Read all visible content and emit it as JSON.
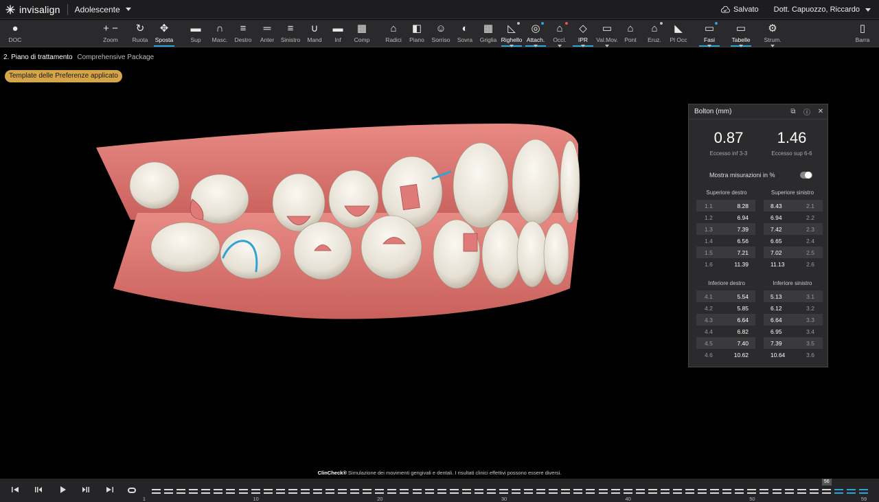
{
  "app": {
    "logo_text": "invisalign",
    "mode": "Adolescente",
    "saved": "Salvato",
    "doctor": "Dott. Capuozzo, Riccardo"
  },
  "toolbar": [
    {
      "label": "DOC",
      "icon": "person-icon"
    },
    {
      "label": "Zoom",
      "icon": "zoom-icon"
    },
    {
      "label": "Ruota",
      "icon": "rotate-icon"
    },
    {
      "label": "Sposta",
      "icon": "move-icon"
    },
    {
      "label": "Sup",
      "icon": "upper-jaw-icon"
    },
    {
      "label": "Masc.",
      "icon": "arch-icon"
    },
    {
      "label": "Destro",
      "icon": "right-view-icon"
    },
    {
      "label": "Anter",
      "icon": "front-view-icon"
    },
    {
      "label": "Sinistro",
      "icon": "left-view-icon"
    },
    {
      "label": "Mand",
      "icon": "mandible-icon"
    },
    {
      "label": "Inf",
      "icon": "lower-jaw-icon"
    },
    {
      "label": "Comp",
      "icon": "compare-grid-icon"
    },
    {
      "label": "Radici",
      "icon": "roots-icon"
    },
    {
      "label": "Piano",
      "icon": "plane-icon"
    },
    {
      "label": "Sorriso",
      "icon": "smile-icon"
    },
    {
      "label": "Sovra",
      "icon": "superimpose-icon"
    },
    {
      "label": "Griglia",
      "icon": "grid-icon"
    },
    {
      "label": "Righello",
      "icon": "ruler-icon"
    },
    {
      "label": "Attach.",
      "icon": "attachment-icon"
    },
    {
      "label": "Occl.",
      "icon": "occlusion-icon"
    },
    {
      "label": "IPR",
      "icon": "ipr-icon"
    },
    {
      "label": "Val.Mov.",
      "icon": "movement-folder-icon"
    },
    {
      "label": "Pont",
      "icon": "pontic-icon"
    },
    {
      "label": "Eruz.",
      "icon": "eruption-icon"
    },
    {
      "label": "Pl Occ",
      "icon": "occlusal-plane-icon"
    },
    {
      "label": "Fasi",
      "icon": "stages-folder-icon"
    },
    {
      "label": "Tabelle",
      "icon": "tables-folder-icon"
    },
    {
      "label": "Strum.",
      "icon": "gear-icon"
    },
    {
      "label": "Barra",
      "icon": "sidebar-icon"
    }
  ],
  "breadcrumb": {
    "step": "2. Piano di trattamento",
    "package": "Comprehensive Package"
  },
  "preference_badge": "Template delle Preferenze applicato",
  "bolton": {
    "title": "Bolton (mm)",
    "inf_value": "0.87",
    "inf_label": "Eccesso inf 3-3",
    "sup_value": "1.46",
    "sup_label": "Eccesso sup 6-6",
    "toggle_label": "Mostra misurazioni in %",
    "upper_right_title": "Superiore destro",
    "upper_left_title": "Superiore sinistro",
    "lower_right_title": "Inferiore destro",
    "lower_left_title": "Inferiore sinistro",
    "upper_right": [
      [
        "1.1",
        "8.28"
      ],
      [
        "1.2",
        "6.94"
      ],
      [
        "1.3",
        "7.39"
      ],
      [
        "1.4",
        "6.56"
      ],
      [
        "1.5",
        "7.21"
      ],
      [
        "1.6",
        "11.39"
      ]
    ],
    "upper_left": [
      [
        "8.43",
        "2.1"
      ],
      [
        "6.94",
        "2.2"
      ],
      [
        "7.42",
        "2.3"
      ],
      [
        "6.65",
        "2.4"
      ],
      [
        "7.02",
        "2.5"
      ],
      [
        "11.13",
        "2.6"
      ]
    ],
    "lower_right": [
      [
        "4.1",
        "5.54"
      ],
      [
        "4.2",
        "5.85"
      ],
      [
        "4.3",
        "6.64"
      ],
      [
        "4.4",
        "6.82"
      ],
      [
        "4.5",
        "7.40"
      ],
      [
        "4.6",
        "10.62"
      ]
    ],
    "lower_left": [
      [
        "5.13",
        "3.1"
      ],
      [
        "6.12",
        "3.2"
      ],
      [
        "6.64",
        "3.3"
      ],
      [
        "6.95",
        "3.4"
      ],
      [
        "7.39",
        "3.5"
      ],
      [
        "10.64",
        "3.6"
      ]
    ]
  },
  "disclaimer": {
    "brand": "ClinCheck®",
    "text": " Simulazione dei movimenti gengivali e dentali. I risultati clinici effettivi possono essere diversi."
  },
  "timeline": {
    "ticks": [
      "1",
      "10",
      "20",
      "30",
      "40",
      "50",
      "59"
    ],
    "current_stage": "56",
    "total_stages": 59
  }
}
